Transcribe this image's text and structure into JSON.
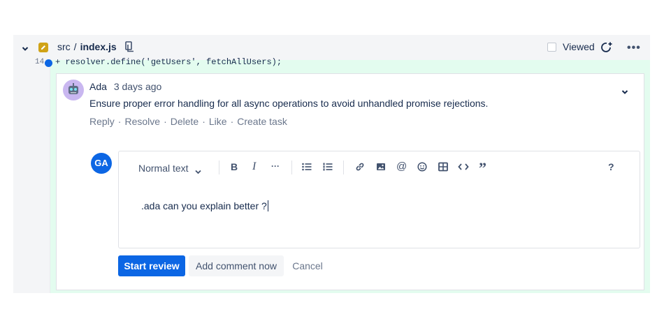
{
  "file_header": {
    "folder": "src",
    "separator": "/",
    "filename": "index.js",
    "viewed_label": "Viewed",
    "more_label": "•••"
  },
  "code": {
    "line_number": "14",
    "line_text": "+ resolver.define('getUsers', fetchAllUsers);"
  },
  "comment": {
    "author": "Ada",
    "time": "3 days ago",
    "text": "Ensure proper error handling for all async operations to avoid unhandled promise rejections.",
    "actions": [
      "Reply",
      "Resolve",
      "Delete",
      "Like",
      "Create task"
    ]
  },
  "reply": {
    "avatar_initials": "GA",
    "text_style": "Normal text",
    "toolbar_help": "?",
    "content": ".ada can you explain better ?"
  },
  "buttons": {
    "start_review": "Start review",
    "add_comment_now": "Add comment now",
    "cancel": "Cancel"
  },
  "colors": {
    "accent": "#0c66e4",
    "added_line_bg": "#e3fcef",
    "file_badge": "#d0a317"
  }
}
